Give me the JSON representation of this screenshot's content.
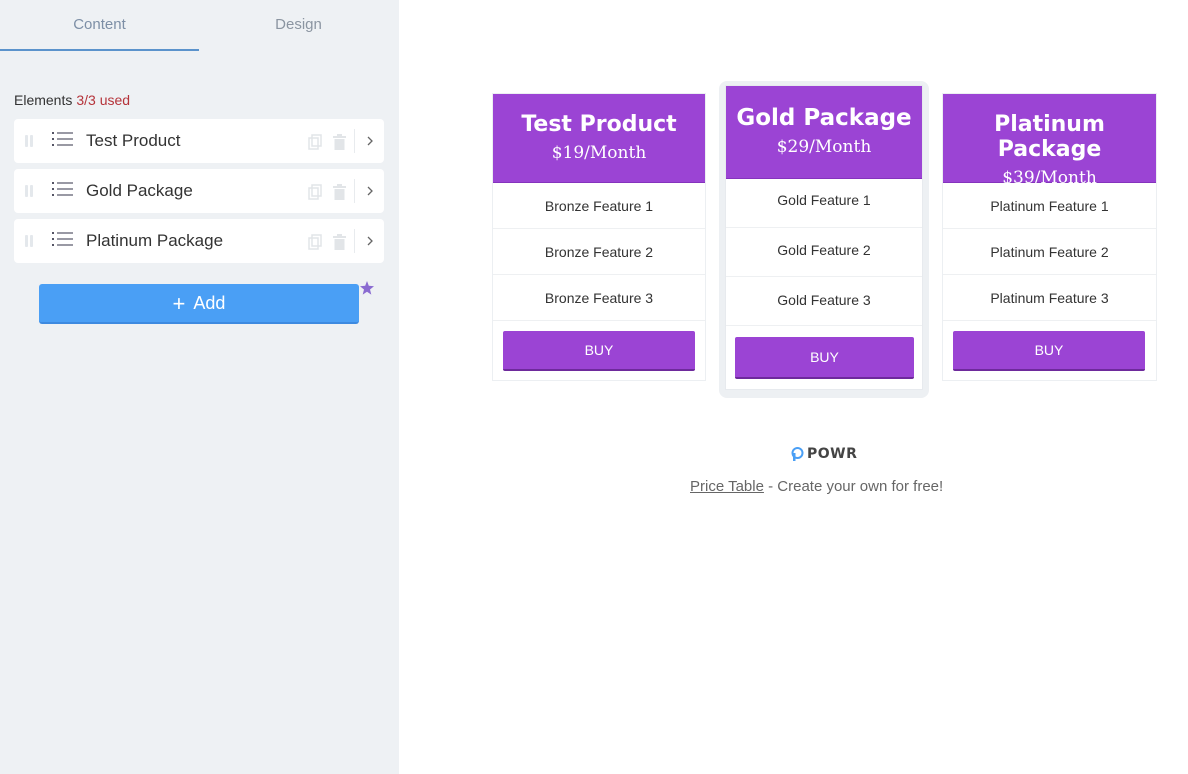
{
  "editor": {
    "tabs": [
      {
        "label": "Content"
      },
      {
        "label": "Design"
      }
    ],
    "elements_label": "Elements",
    "elements_used": "3/3 used",
    "elements": [
      {
        "label": "Test Product"
      },
      {
        "label": "Gold Package"
      },
      {
        "label": "Platinum Package"
      }
    ],
    "add_label": "Add"
  },
  "price_table": {
    "columns": [
      {
        "title": "Test Product",
        "price": "$19/Month",
        "features": [
          "Bronze Feature 1",
          "Bronze Feature 2",
          "Bronze Feature 3"
        ],
        "button": "BUY"
      },
      {
        "title": "Gold Package",
        "price": "$29/Month",
        "features": [
          "Gold Feature 1",
          "Gold Feature 2",
          "Gold Feature 3"
        ],
        "button": "BUY",
        "highlighted": true
      },
      {
        "title": "Platinum Package",
        "price": "$39/Month",
        "features": [
          "Platinum Feature 1",
          "Platinum Feature 2",
          "Platinum Feature 3"
        ],
        "button": "BUY"
      }
    ]
  },
  "footer": {
    "brand": "POWR",
    "link_text": "Price Table",
    "tagline": " - Create your own for free!"
  },
  "colors": {
    "accent_purple": "#9b44d4",
    "add_button_blue": "#4a9ff5",
    "used_count_red": "#b5333a"
  },
  "icons": [
    "drag-handle-icon",
    "list-icon",
    "copy-icon",
    "trash-icon",
    "chevron-right-icon",
    "plus-icon",
    "star-icon",
    "powr-logo-icon"
  ]
}
